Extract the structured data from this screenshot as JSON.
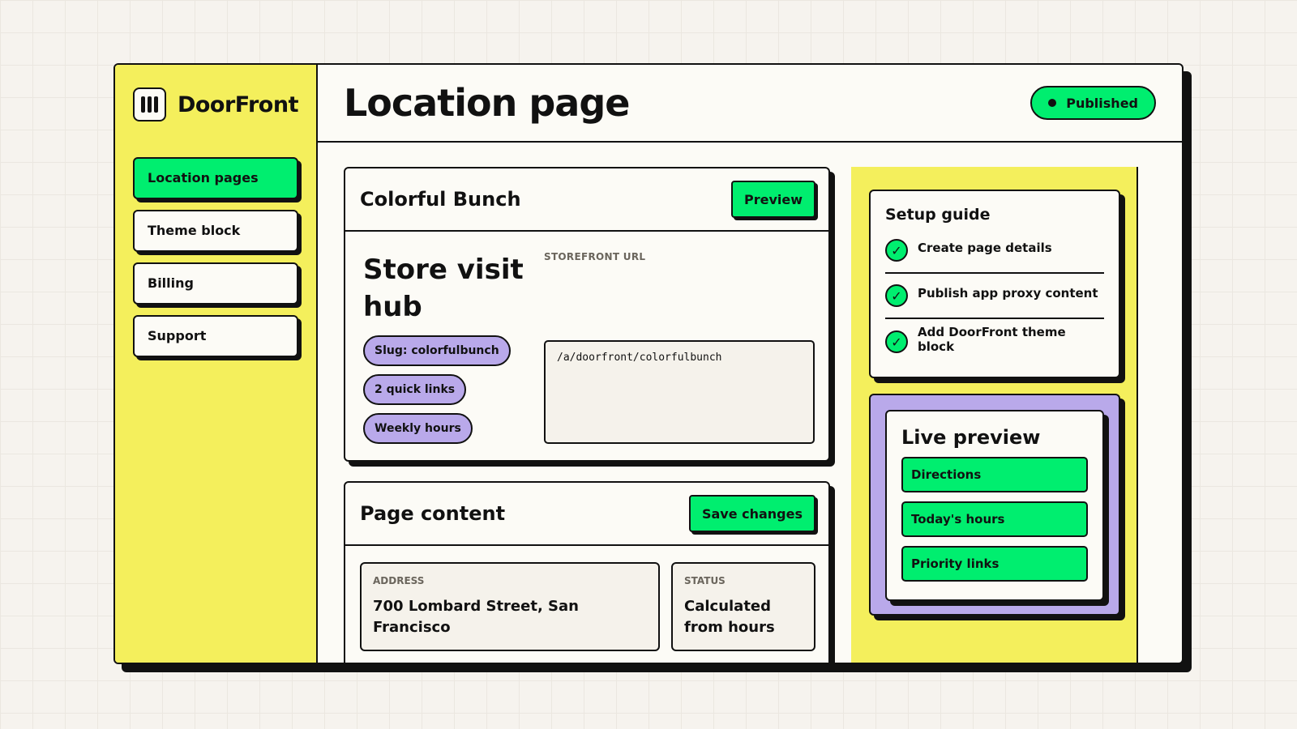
{
  "brand": {
    "name": "DoorFront",
    "logo_icon": "bars-logo-icon"
  },
  "sidebar": {
    "items": [
      {
        "label": "Location pages",
        "active": true
      },
      {
        "label": "Theme block",
        "active": false
      },
      {
        "label": "Billing",
        "active": false
      },
      {
        "label": "Support",
        "active": false
      }
    ]
  },
  "header": {
    "title": "Location page",
    "status": "Published"
  },
  "store_card": {
    "name": "Colorful Bunch",
    "preview_label": "Preview",
    "hub_title": "Store visit hub",
    "tags": [
      "Slug: colorfulbunch",
      "2 quick links",
      "Weekly hours"
    ],
    "url_label": "STOREFRONT URL",
    "url_value": "/a/doorfront/colorfulbunch"
  },
  "content_card": {
    "title": "Page content",
    "save_label": "Save changes",
    "address_label": "ADDRESS",
    "address_value": "700 Lombard Street, San Francisco",
    "status_label": "STATUS",
    "status_value": "Calculated from hours"
  },
  "setup_guide": {
    "title": "Setup guide",
    "steps": [
      {
        "label": "Create page details",
        "done": true
      },
      {
        "label": "Publish app proxy content",
        "done": true
      },
      {
        "label": "Add DoorFront theme block",
        "done": true
      }
    ]
  },
  "live_preview": {
    "title": "Live preview",
    "buttons": [
      "Directions",
      "Today's hours",
      "Priority links"
    ]
  },
  "colors": {
    "accent_green": "#00ee6f",
    "sidebar_yellow": "#f4ef5c",
    "tag_purple": "#b9a9ea",
    "ink": "#111111"
  }
}
